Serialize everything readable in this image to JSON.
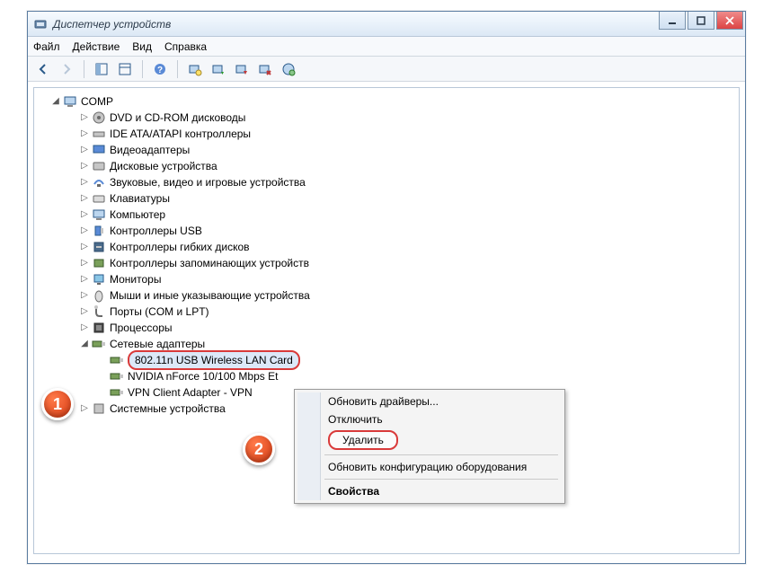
{
  "window": {
    "title": "Диспетчер устройств"
  },
  "menu": {
    "file": "Файл",
    "action": "Действие",
    "view": "Вид",
    "help": "Справка"
  },
  "tree": {
    "root": "COMP",
    "items": [
      "DVD и CD-ROM дисководы",
      "IDE ATA/ATAPI контроллеры",
      "Видеоадаптеры",
      "Дисковые устройства",
      "Звуковые, видео и игровые устройства",
      "Клавиатуры",
      "Компьютер",
      "Контроллеры USB",
      "Контроллеры гибких дисков",
      "Контроллеры запоминающих устройств",
      "Мониторы",
      "Мыши и иные указывающие устройства",
      "Порты (COM и LPT)",
      "Процессоры",
      "Сетевые адаптеры"
    ],
    "network_children": [
      "802.11n USB Wireless LAN Card",
      "NVIDIA nForce 10/100 Mbps Et",
      "VPN Client Adapter - VPN"
    ],
    "after": "Системные устройства"
  },
  "context_menu": {
    "update": "Обновить драйверы...",
    "disable": "Отключить",
    "delete": "Удалить",
    "rescan": "Обновить конфигурацию оборудования",
    "properties": "Свойства"
  },
  "callouts": {
    "one": "1",
    "two": "2"
  },
  "colors": {
    "highlight_border": "#d93a3a",
    "selection_bg": "#dce8f8",
    "callout_fill": "#e64a19"
  }
}
